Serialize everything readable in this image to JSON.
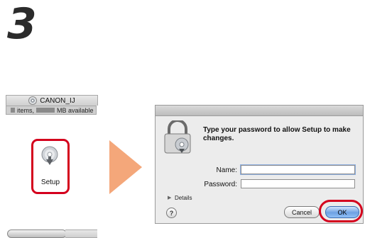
{
  "step": {
    "number": "3"
  },
  "finder": {
    "title": "CANON_IJ",
    "status_items": "items,",
    "status_available": "MB available",
    "setup_label": "Setup"
  },
  "dialog": {
    "message": "Type your password to allow Setup to make changes.",
    "name_label": "Name:",
    "name_value": "",
    "password_label": "Password:",
    "password_value": "",
    "details_label": "Details",
    "help_label": "?",
    "cancel_label": "Cancel",
    "ok_label": "OK"
  },
  "colors": {
    "highlight": "#d4001d",
    "arrow": "#f4a77a",
    "ok_button": "#6ea1e3"
  }
}
